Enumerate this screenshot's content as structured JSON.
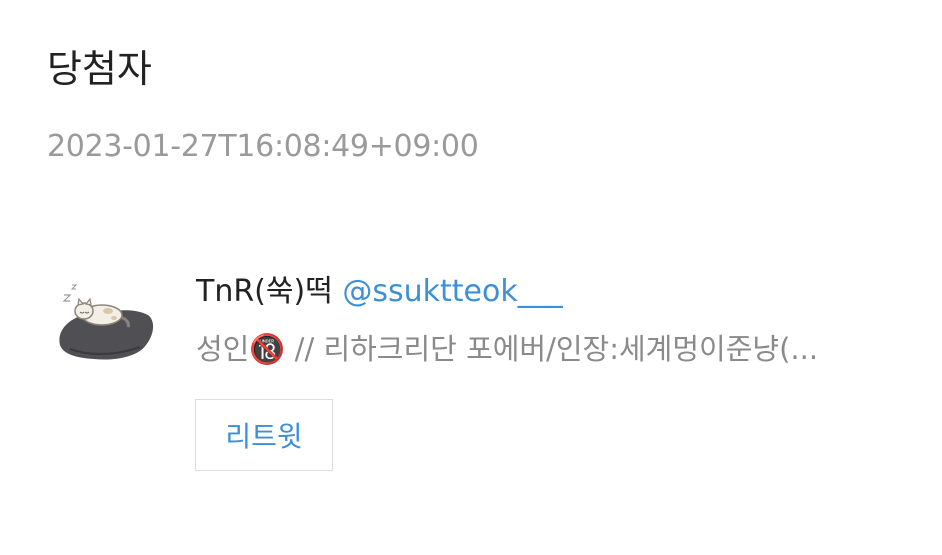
{
  "section": {
    "title": "당첨자",
    "timestamp": "2023-01-27T16:08:49+09:00"
  },
  "winner": {
    "avatar_icon": "sleeping-cat-avatar",
    "display_name": "TnR(쑥)떡",
    "handle": "@ssuktteok___",
    "bio": "성인🔞 // 리하크리단 포에버/인장:세계멍이준냥(..."
  },
  "actions": {
    "retweet_label": "리트윗"
  },
  "colors": {
    "link": "#3d8fd6",
    "muted_text": "#9a9a9a",
    "primary_text": "#222222",
    "button_border": "#dddddd"
  }
}
